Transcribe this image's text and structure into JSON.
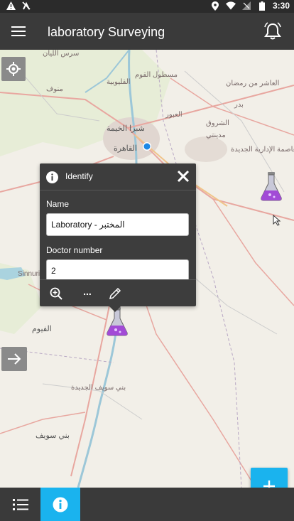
{
  "statusbar": {
    "time": "3:30",
    "left_icons": [
      "warning-icon",
      "no-tracking-icon"
    ],
    "right_icons": [
      "location-icon",
      "wifi-icon",
      "signal-icon",
      "battery-icon"
    ]
  },
  "appbar": {
    "title": "laboratory Surveying",
    "menu_icon": "hamburger-icon",
    "notify_icon": "bell-icon"
  },
  "map": {
    "labels": [
      {
        "text": "العاشر من رمضان"
      },
      {
        "text": "شبرا الخيمة"
      },
      {
        "text": "القاهرة"
      },
      {
        "text": "الشروق"
      },
      {
        "text": "مدينتي"
      },
      {
        "text": "العاصمة الإدارية الجديدة"
      },
      {
        "text": "القليوبية"
      },
      {
        "text": "العبور"
      },
      {
        "text": "بدر"
      },
      {
        "text": "Sinnuris"
      },
      {
        "text": "الفيوم"
      },
      {
        "text": "بني سويف"
      },
      {
        "text": "بني سويف الجديدة"
      },
      {
        "text": "مسطول القوم"
      },
      {
        "text": "منوف"
      },
      {
        "text": "سرس الليان"
      }
    ]
  },
  "popup": {
    "title": "Identify",
    "fields": [
      {
        "label": "Name",
        "value": "Laboratory - المختبر"
      },
      {
        "label": "Doctor number",
        "value": "2"
      }
    ],
    "tools": {
      "more_label": "..."
    }
  },
  "colors": {
    "accent": "#1ab3ee",
    "bar": "#3a3a3a",
    "panel": "#3d3d3d"
  }
}
